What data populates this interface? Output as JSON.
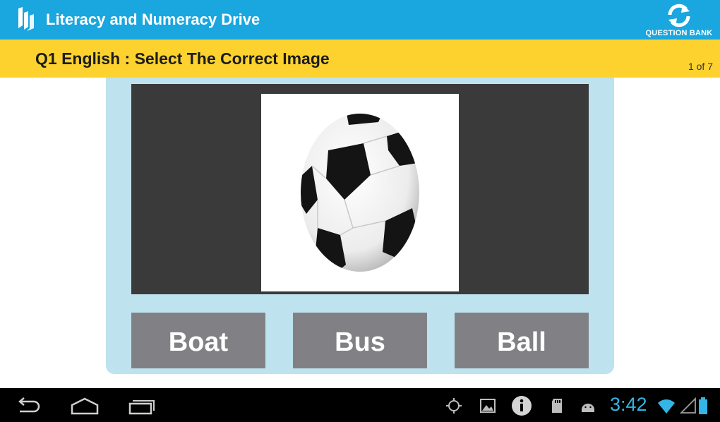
{
  "app_bar": {
    "title": "Literacy and Numeracy Drive",
    "question_bank_label": "QUESTION BANK",
    "icons": {
      "logo": "app-logo-icon",
      "question_bank": "refresh-icon"
    }
  },
  "question": {
    "title": "Q1 English : Select The Correct Image",
    "counter": "1 of 7"
  },
  "image": {
    "subject": "soccer-ball"
  },
  "answers": [
    {
      "label": "Boat"
    },
    {
      "label": "Bus"
    },
    {
      "label": "Ball"
    }
  ],
  "status_bar": {
    "time": "3:42",
    "icons": [
      "gps-icon",
      "gallery-icon",
      "info-icon",
      "sd-card-icon",
      "android-debug-icon",
      "wifi-icon",
      "signal-icon",
      "battery-icon"
    ]
  },
  "colors": {
    "app_bar": "#1aa6df",
    "question_bar": "#fdd22f",
    "card": "#bee3ee",
    "image_panel": "#3a3a3a",
    "answer_button": "#818185",
    "clock": "#33b5e5"
  }
}
